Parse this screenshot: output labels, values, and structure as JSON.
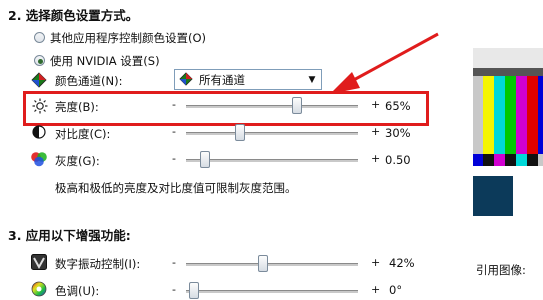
{
  "section2": {
    "heading": "2. 选择颜色设置方式。",
    "radio_other": "其他应用程序控制颜色设置(O)",
    "radio_nvidia": "使用 NVIDIA 设置(S)",
    "channel_label": "颜色通道(N):",
    "channel_value": "所有通道",
    "brightness": {
      "label": "亮度(B):",
      "minus": "-",
      "plus": "+",
      "value": "65%",
      "level": 0.65
    },
    "contrast": {
      "label": "对比度(C):",
      "minus": "-",
      "plus": "+",
      "value": "30%",
      "level": 0.3
    },
    "gamma": {
      "label": "灰度(G):",
      "minus": "-",
      "plus": "+",
      "value": "0.50",
      "level": 0.1
    },
    "note": "极高和极低的亮度及对比度值可限制灰度范围。"
  },
  "section3": {
    "heading": "3. 应用以下增强功能:",
    "vibrance": {
      "label": "数字振动控制(I):",
      "minus": "-",
      "plus": "+",
      "value": "42%",
      "level": 0.42
    },
    "hue": {
      "label": "色调(U):",
      "minus": "-",
      "plus": "+",
      "value": "0°",
      "level": 0.0
    }
  },
  "reference_label": "引用图像:",
  "colors": {
    "annotation_red": "#e01c1c",
    "test_bars": [
      "#c8c8c8",
      "#f5f500",
      "#00d8d8",
      "#00c800",
      "#d000d0",
      "#e00000",
      "#0000d8"
    ]
  }
}
